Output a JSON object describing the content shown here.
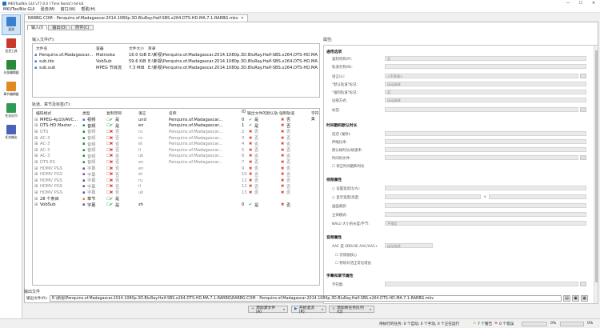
{
  "window": {
    "title": "MKVToolNix GUI v77.0.0 ('Time Bomb') 64-bit",
    "min": "—",
    "max": "☐",
    "close": "✕"
  },
  "menu": [
    "MKVToolNix GUI",
    "混流(M)",
    "窗口(W)",
    "帮助(H)"
  ],
  "sidebar": [
    {
      "label": "混流",
      "color": "#3b7fd0"
    },
    {
      "label": "信息工具",
      "color": "#c83a2b"
    },
    {
      "label": "头部编辑器",
      "color": "#2a8a3a"
    },
    {
      "label": "章节编辑器",
      "color": "#e08a20"
    },
    {
      "label": "任务队列",
      "color": "#2f9a55"
    },
    {
      "label": "任务输出",
      "color": "#4a63b8"
    }
  ],
  "doc_tab": {
    "label": "RARBG.COM - Penquins.of.Madagascar.2014.1080p.3D.BluRay.Half-SBS.x264.DTS-HD.MA.7.1-RARBG.mkv",
    "close": "✕"
  },
  "subtabs": [
    "输入(I)",
    "输出(O)",
    "附件(C)"
  ],
  "input_files": {
    "label": "输入文件(F):",
    "headers": [
      "文件名",
      "容器",
      "文件大小",
      "目录"
    ],
    "rows": [
      {
        "name": "Penquins.of.Madagascar...",
        "container": "Matroska",
        "size": "16.0 GiB",
        "dir": "E:\\新视\\Penquins.of.Madagascar.2014.1080p.3D.BluRay.Half-SBS.x264.DTS-HD.MA.7.1-RARBG"
      },
      {
        "name": "sub.idx",
        "container": "VobSub",
        "size": "59.6 KiB",
        "dir": "E:\\新视\\Penquins.of.Madagascar.2014.1080p.3D.BluRay.Half-SBS.x264.DTS-HD.MA.7.1-RARBG"
      },
      {
        "name": "sub.sub",
        "container": "MPEG 节目流",
        "size": "7.3 MiB",
        "dir": "E:\\新视\\Penquins.of.Madagascar.2014.1080p.3D.BluRay.Half-SBS.x264.DTS-HD.MA.7.1-RARBG"
      }
    ]
  },
  "tracks": {
    "label": "轨道、章节及标签(T):",
    "headers": [
      "编码格式",
      "类型",
      "复制项目",
      "语言",
      "名称",
      "ID",
      "输出文件的默认轨",
      "强制轨道",
      "字符集"
    ],
    "rows": [
      {
        "codec": "MPEG-4p10/AVC...",
        "type": "视频",
        "copy": "是",
        "copy_ok": true,
        "lang": "und",
        "name": "Penquins.of.Madagascar...",
        "id": "0",
        "def": "是",
        "def_ok": true,
        "forced": "否",
        "color": "#3b7fd0"
      },
      {
        "codec": "DTS-HD Master ...",
        "type": "音频",
        "copy": "是",
        "copy_ok": true,
        "lang": "en",
        "name": "Penquins.of.Madagascar...",
        "id": "1",
        "def": "是",
        "def_ok": true,
        "forced": "否",
        "color": "#2a8a3a"
      },
      {
        "codec": "DTS",
        "type": "音频",
        "copy": "否",
        "copy_ok": false,
        "lang": "ru",
        "name": "Penquins.of.Madagascar...",
        "id": "2",
        "def": "否",
        "def_ok": false,
        "forced": "否",
        "color": "#2a8a3a"
      },
      {
        "codec": "AC-3",
        "type": "音频",
        "copy": "否",
        "copy_ok": false,
        "lang": "ru",
        "name": "Penquins.of.Madagascar...",
        "id": "3",
        "def": "否",
        "def_ok": false,
        "forced": "否",
        "color": "#2a8a3a"
      },
      {
        "codec": "AC-3",
        "type": "音频",
        "copy": "否",
        "copy_ok": false,
        "lang": "et",
        "name": "Penquins.of.Madagascar...",
        "id": "4",
        "def": "否",
        "def_ok": false,
        "forced": "否",
        "color": "#2a8a3a"
      },
      {
        "codec": "AC-3",
        "type": "音频",
        "copy": "否",
        "copy_ok": false,
        "lang": "lt",
        "name": "Penquins.of.Madagascar...",
        "id": "5",
        "def": "否",
        "def_ok": false,
        "forced": "否",
        "color": "#2a8a3a"
      },
      {
        "codec": "AC-3",
        "type": "音频",
        "copy": "否",
        "copy_ok": false,
        "lang": "uk",
        "name": "Penquins.of.Madagascar...",
        "id": "6",
        "def": "否",
        "def_ok": false,
        "forced": "否",
        "color": "#2a8a3a"
      },
      {
        "codec": "DTS-ES",
        "type": "音频",
        "copy": "否",
        "copy_ok": false,
        "lang": "en",
        "name": "Penquins.of.Madagascar...",
        "id": "7",
        "def": "否",
        "def_ok": false,
        "forced": "否",
        "color": "#2a8a3a"
      },
      {
        "codec": "HDMV PGS",
        "type": "字幕",
        "copy": "否",
        "copy_ok": false,
        "lang": "en",
        "name": "",
        "id": "9",
        "def": "否",
        "def_ok": false,
        "forced": "否",
        "color": "#6b4fa8"
      },
      {
        "codec": "HDMV PGS",
        "type": "字幕",
        "copy": "否",
        "copy_ok": false,
        "lang": "et",
        "name": "",
        "id": "10",
        "def": "否",
        "def_ok": false,
        "forced": "否",
        "color": "#6b4fa8"
      },
      {
        "codec": "HDMV PGS",
        "type": "字幕",
        "copy": "否",
        "copy_ok": false,
        "lang": "ru",
        "name": "",
        "id": "11",
        "def": "否",
        "def_ok": false,
        "forced": "否",
        "color": "#6b4fa8"
      },
      {
        "codec": "HDMV PGS",
        "type": "字幕",
        "copy": "否",
        "copy_ok": false,
        "lang": "lt",
        "name": "",
        "id": "12",
        "def": "否",
        "def_ok": false,
        "forced": "否",
        "color": "#6b4fa8"
      },
      {
        "codec": "HDMV PGS",
        "type": "字幕",
        "copy": "否",
        "copy_ok": false,
        "lang": "uk",
        "name": "",
        "id": "13",
        "def": "否",
        "def_ok": false,
        "forced": "否",
        "color": "#6b4fa8"
      },
      {
        "codec": "28 个条目",
        "type": "章节",
        "copy": "是",
        "copy_ok": true,
        "lang": "",
        "name": "",
        "id": "",
        "def": "",
        "def_ok": null,
        "forced": "",
        "color": "#e08a20"
      },
      {
        "codec": "VobSub",
        "type": "字幕",
        "copy": "是",
        "copy_ok": true,
        "lang": "zh",
        "name": "",
        "id": "0",
        "def": "是",
        "def_ok": true,
        "forced": "否",
        "color": "#6b4fa8"
      }
    ]
  },
  "properties": {
    "label": "属性:",
    "sections": {
      "general": "通用选项",
      "timing": "时间戳和默认时长",
      "video": "视频属性",
      "audio": "音频属性",
      "subs": "字幕和章节属性"
    },
    "general_fields": [
      {
        "label": "复制项目(P):",
        "value": "否"
      },
      {
        "label": "轨道名称(N):",
        "value": ""
      },
      {
        "label": "语言(L):",
        "value": "<不更改>"
      },
      {
        "label": "\"默认轨道\"标记:",
        "value": "自动选择"
      },
      {
        "label": "\"强制轨道\"标记:",
        "value": "否"
      },
      {
        "label": "压缩方式:",
        "value": "自动选择"
      },
      {
        "label": "标签:",
        "value": ""
      }
    ],
    "timing_fields": [
      {
        "label": "延迟 (毫秒):",
        "value": ""
      },
      {
        "label": "伸缩比率:",
        "value": ""
      },
      {
        "label": "默认帧时长/帧速率:",
        "value": ""
      },
      {
        "label": "时间码文件:",
        "value": ""
      }
    ],
    "timing_check": "修正时间戳和时长",
    "video_fields": [
      {
        "label": "设置宽高比(A):",
        "value": ""
      },
      {
        "label": "显示宽度/高度:",
        "value": ""
      },
      {
        "label": "画面裁剪:",
        "value": ""
      },
      {
        "label": "立体模式:",
        "value": ""
      },
      {
        "label": "NALU 大小的长度/字节:",
        "value": "不指定"
      }
    ],
    "height_sep": "x",
    "audio_field": {
      "label": "AAC 是 SBR/HE-AAC/AAC+",
      "value": "自动选择"
    },
    "audio_checks": [
      "仅保留核心",
      "移除对话正常化增益"
    ],
    "subs_field": {
      "label": "字符集:",
      "value": ""
    }
  },
  "output": {
    "label": "输出文件",
    "field_label": "输出文件(R):",
    "path": "E:\\新视\\Penquins.of.Madagascar.2014.1080p.3D.BluRay.Half-SBS.x264.DTS-HD.MA.7.1-RARBG\\RARBG.COM - Penquins.of.Madagascar.2014.1080p.3D.BluRay.Half-SBS.x264.DTS-HD.MA.7.1-RARBG.mkv"
  },
  "actions": {
    "add": "添加源文件(A)",
    "start": "开始混流(R)",
    "queue": "添加到任务队列(Q)"
  },
  "status": {
    "jobs": "待执行的任务: 0 个自动, 0 个手动, 0 个正在运行",
    "warnings": "7 个警告",
    "errors": "0 个错误",
    "progress1": "0%",
    "progress2": "0%"
  }
}
